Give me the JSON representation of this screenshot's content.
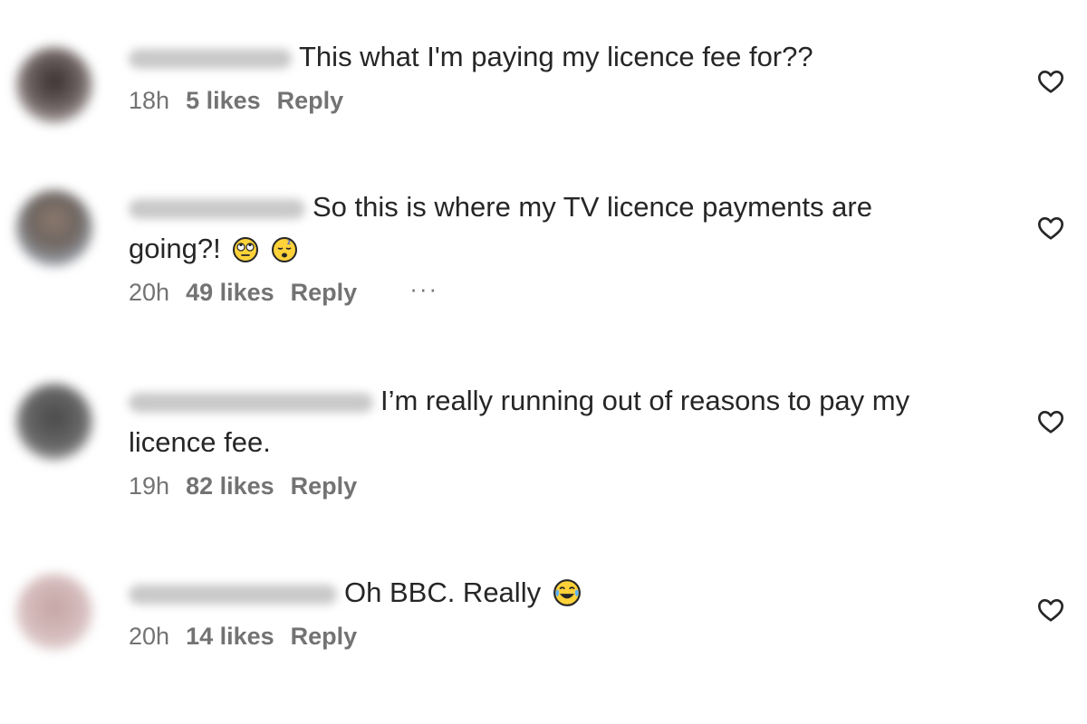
{
  "comments": [
    {
      "text": "This what I'm paying my licence fee for??",
      "time": "18h",
      "likes": "5 likes",
      "reply": "Reply"
    },
    {
      "text_line1": "So this is where my TV licence payments are",
      "text_line2": "going?!",
      "time": "20h",
      "likes": "49 likes",
      "reply": "Reply",
      "more": "···",
      "emojis": [
        "face-with-rolling-eyes-icon",
        "sleeping-face-icon"
      ]
    },
    {
      "text_line1": "I’m really running out of reasons to pay my",
      "text_line2": "licence fee.",
      "time": "19h",
      "likes": "82 likes",
      "reply": "Reply"
    },
    {
      "text": "Oh BBC. Really",
      "time": "20h",
      "likes": "14 likes",
      "reply": "Reply",
      "emojis": [
        "face-with-tears-of-joy-icon"
      ]
    }
  ],
  "colors": {
    "text": "#262626",
    "meta": "#737373",
    "username_blur": "#c9c9c9"
  }
}
